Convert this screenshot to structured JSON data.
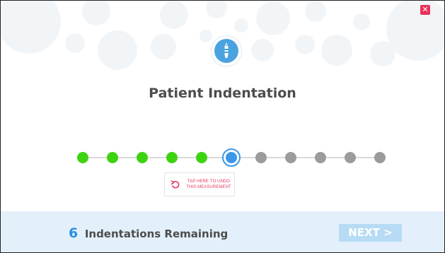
{
  "dialog": {
    "close_label": "✕",
    "title": "Patient Indentation"
  },
  "progress": {
    "total_steps": 11,
    "completed_steps": 5,
    "current_step": 6,
    "colors": {
      "done": "#3ed311",
      "current": "#3b97ea",
      "todo": "#9b9b9b"
    }
  },
  "undo": {
    "line1": "TAP HERE TO UNDO",
    "line2": "THIS MEASUREMENT",
    "icon": "undo-arrow-icon",
    "color": "#e23b5f"
  },
  "footer": {
    "remaining_count": "6",
    "remaining_label": "Indentations Remaining",
    "next_label": "NEXT >"
  },
  "icons": {
    "tool": "pen-nib-icon",
    "close": "close-icon"
  }
}
